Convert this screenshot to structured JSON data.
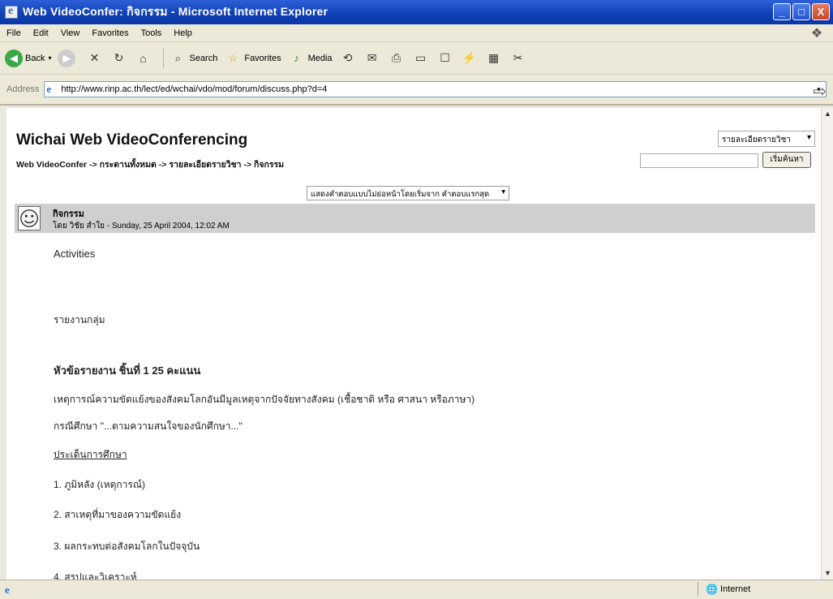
{
  "window": {
    "title": "Web VideoConfer: กิจกรรม - Microsoft Internet Explorer",
    "minimize": "_",
    "maximize": "□",
    "close": "X"
  },
  "menu": [
    "File",
    "Edit",
    "View",
    "Favorites",
    "Tools",
    "Help"
  ],
  "toolbar": {
    "back": "Back",
    "search": "Search",
    "favorites": "Favorites",
    "media": "Media"
  },
  "address": {
    "label": "Address",
    "url": "http://www.rinp.ac.th/lect/ed/wchai/vdo/mod/forum/discuss.php?d=4"
  },
  "page": {
    "site_title": "Wichai Web VideoConferencing",
    "breadcrumb": [
      "Web VideoConfer",
      "กระดานทั้งหมด",
      "รายละเอียดรายวิชา",
      "กิจกรรม"
    ],
    "breadcrumb_sep": " -> ",
    "jump_select": "รายละเอียดรายวิชา",
    "search_button": "เริ่มค้นหา",
    "display_mode": "แสดงคำตอบแบบไม่ย่อหน้าโดยเริ่มจาก คำตอบแรกสุด"
  },
  "post": {
    "subject": "กิจกรรม",
    "byline": "โดย วิชัย สำใย - Sunday, 25 April 2004, 12:02 AM",
    "body": {
      "activities": "Activities",
      "report": "รายงานกลุ่ม",
      "topic": "หัวข้อรายงาน ชิ้นที่ 1   25 คะแนน",
      "event": "เหตุการณ์ความขัดแย้งของสังคมโลกอันมีมูลเหตุจากปัจจัยทางสังคม (เชื้อชาติ หรือ ศาสนา หรือภาษา)",
      "case": "กรณีศึกษา \"...ตามความสนใจของนักศึกษา...\"",
      "issues_heading": "ประเด็นการศึกษา",
      "issue1": "1.  ภูมิหลัง (เหตุการณ์)",
      "issue2": "2.  สาเหตุที่มาของความขัดแย้ง",
      "issue3": "3.  ผลกระทบต่อสังคมโลกในปัจจุบัน",
      "issue4": "4.  สรุปและวิเคราะห์"
    }
  },
  "status": {
    "zone": "Internet"
  }
}
